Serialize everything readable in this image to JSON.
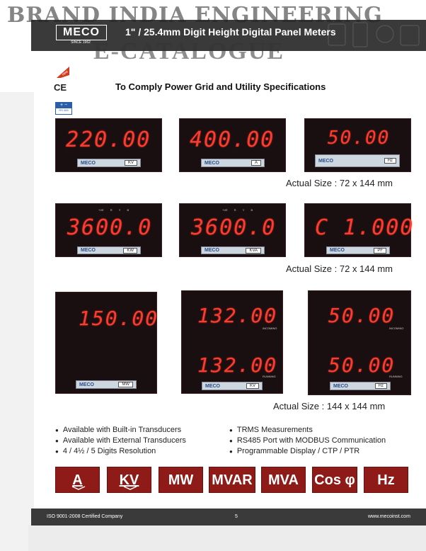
{
  "watermark": {
    "brand": "BRAND INDIA ENGINEERING",
    "catalogue": "E-CATALOGUE"
  },
  "header": {
    "logo": "MECO",
    "logo_sub": "SINCE 1962",
    "title": "1\" / 25.4mm Digit Height Digital Panel Meters"
  },
  "badges": {
    "new": "new",
    "ce": "CE",
    "rs": "RS 485"
  },
  "heading": "To Comply Power Grid and Utility Specifications",
  "meters_row1": [
    {
      "digits": "220.00",
      "unit": "KV"
    },
    {
      "digits": "400.00",
      "unit": "A"
    },
    {
      "digits": "50.00",
      "unit": "Hz"
    }
  ],
  "meters_row2": [
    {
      "digits": "3600.0",
      "unit": "KW",
      "leds": [
        "+VE",
        "R",
        "Y",
        "B"
      ]
    },
    {
      "digits": "3600.0",
      "unit": "KVA",
      "leds": [
        "+VE",
        "R",
        "Y",
        "B"
      ]
    },
    {
      "digits": "C 1.000",
      "unit": "PF"
    }
  ],
  "meters_row3": [
    {
      "digits": "150.00",
      "unit": "MW"
    },
    {
      "top": "132.00",
      "top_label": "INCOMING",
      "bottom": "132.00",
      "bottom_label": "RUNNING",
      "unit": "KV"
    },
    {
      "top": "50.00",
      "top_label": "INCOMING",
      "bottom": "50.00",
      "bottom_label": "RUNNING",
      "unit": "Hz"
    }
  ],
  "plate_logo": "MECO",
  "sizes": {
    "small": "Actual Size : 72 x 144 mm",
    "large": "Actual Size : 144 x 144 mm"
  },
  "features_left": [
    "Available with Built-in Transducers",
    "Available with External Transducers",
    "4 / 4½ / 5 Digits Resolution"
  ],
  "features_right": [
    "TRMS Measurements",
    "RS485 Port with MODBUS Communication",
    "Programmable Display / CTP / PTR"
  ],
  "buttons": [
    "A",
    "KV",
    "MW",
    "MVAR",
    "MVA",
    "Cos φ",
    "Hz"
  ],
  "footer": {
    "left": "ISO 9001-2008 Certified Company",
    "page": "5",
    "right": "www.mecoinst.com"
  },
  "colors": {
    "accent": "#8e1b17",
    "digit": "#ff3b30",
    "header": "#3a3a3a"
  }
}
